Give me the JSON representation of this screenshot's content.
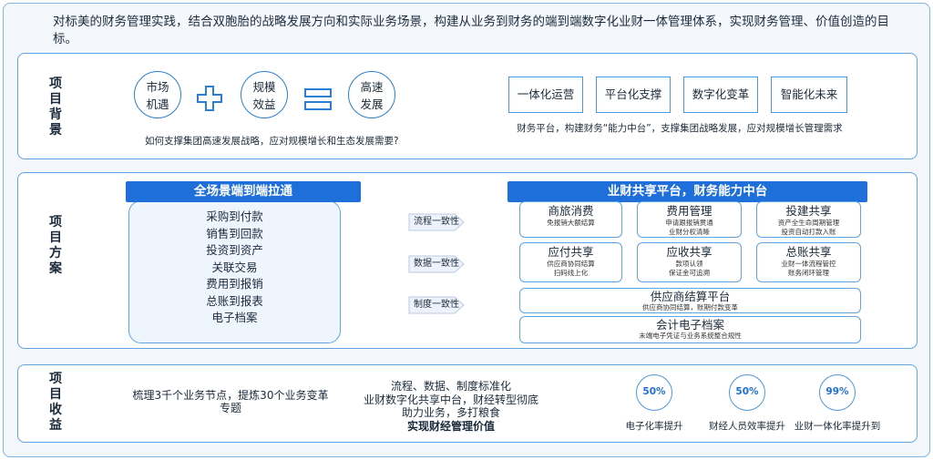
{
  "intro": "对标美的财务管理实践，结合双胞胎的战略发展方向和实际业务场景，构建从业务到财务的端到端数字化业财一体管理体系，实现财务管理、价值创造的目标。",
  "background": {
    "title": "项目背景",
    "circles": [
      {
        "line1": "市场",
        "line2": "机遇"
      },
      {
        "line1": "规模",
        "line2": "效益"
      },
      {
        "line1": "高速",
        "line2": "发展"
      }
    ],
    "question": "如何支撑集团高速发展战略，应对规模增长和生态发展需要?",
    "boxes": [
      "一体化运营",
      "平台化支撑",
      "数字化变革",
      "智能化未来"
    ],
    "boxes_caption": "财务平台，构建财务“能力中台”，支撑集团战略发展，应对规模增长管理需求"
  },
  "solution": {
    "title": "项目方案",
    "left_header": "全场景端到端拉通",
    "left_items": [
      "采购到付款",
      "销售到回款",
      "投资到资产",
      "关联交易",
      "费用到报销",
      "总账到报表",
      "电子档案"
    ],
    "arrows": [
      "流程一致性",
      "数据一致性",
      "制度一致性"
    ],
    "right_header": "业财共享平台，财务能力中台",
    "cells": [
      {
        "title": "商旅消费",
        "sub": [
          "免报销大额结算"
        ]
      },
      {
        "title": "费用管理",
        "sub": [
          "申请跟报销贯通",
          "业财分权清晰"
        ]
      },
      {
        "title": "投建共享",
        "sub": [
          "资产全生命周期管理",
          "投资自动打款入账"
        ]
      },
      {
        "title": "应付共享",
        "sub": [
          "供应商协同结算",
          "扫码线上化"
        ]
      },
      {
        "title": "应收共享",
        "sub": [
          "款项认领",
          "保证金可追溯"
        ]
      },
      {
        "title": "总账共享",
        "sub": [
          "业财一体流程管控",
          "账务闭环管理"
        ]
      }
    ],
    "wide_cells": [
      {
        "title": "供应商结算平台",
        "sub": "供应商协同结算，账期付款变革"
      },
      {
        "title": "会计电子档案",
        "sub": "末端电子凭证与业务系统整合规性"
      }
    ]
  },
  "benefit": {
    "title": "项目收益",
    "text1": "梳理3千个业务节点，提炼30个业务变革专题",
    "text2": [
      "流程、数据、制度标准化",
      "业财数字化共享中台，财经转型彻底",
      "助力业务，多打粮食"
    ],
    "text2_bold": "实现财经管理价值",
    "metrics": [
      {
        "value": "50%",
        "label": "电子化率提升"
      },
      {
        "value": "50%",
        "label": "财经人员效率提升"
      },
      {
        "value": "99%",
        "label": "业财一体化率提升到"
      }
    ]
  },
  "colors": {
    "accent": "#1e6fd9",
    "border": "#5fa3e3",
    "bg": "#f4f8fd"
  }
}
